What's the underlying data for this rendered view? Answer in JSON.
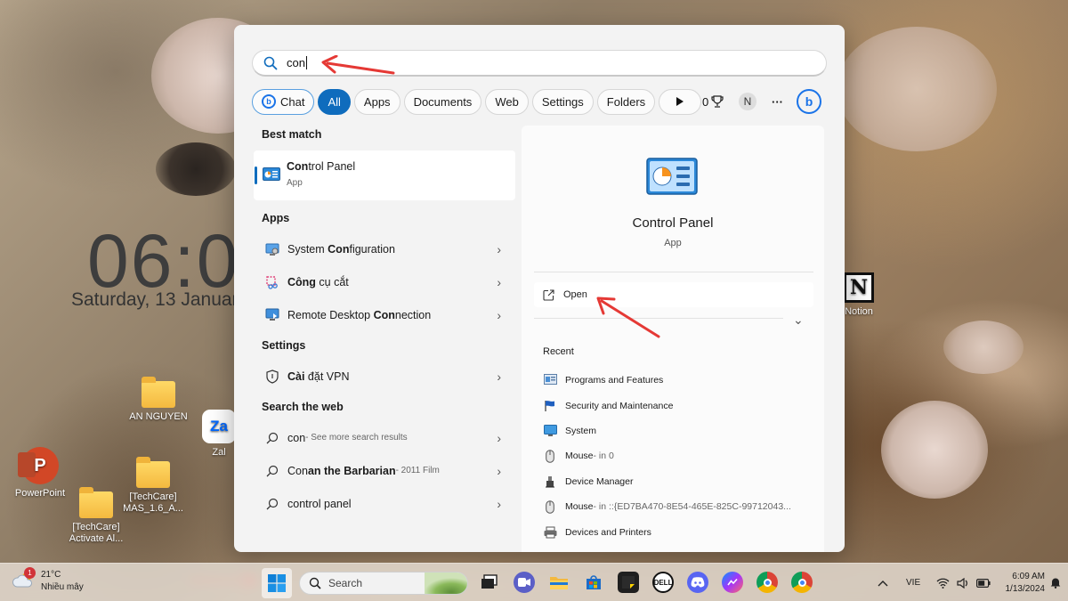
{
  "desktop": {
    "clock": "06:0",
    "date": "Saturday, 13 Januar",
    "icons": [
      {
        "label": "AN NGUYEN"
      },
      {
        "label": "Zal"
      },
      {
        "label": "PowerPoint"
      },
      {
        "label": "[TechCare]\nMAS_1.6_A..."
      },
      {
        "label": "[TechCare]\nActivate Al..."
      },
      {
        "label": "Notion"
      }
    ]
  },
  "search": {
    "query": "con",
    "filters": {
      "chat": "Chat",
      "all": "All",
      "apps": "Apps",
      "documents": "Documents",
      "web": "Web",
      "settings": "Settings",
      "folders": "Folders",
      "reward_points": "0",
      "account_initial": "N",
      "more": "···"
    },
    "best_match": {
      "title": "Best match",
      "name_bold": "Con",
      "name_rest": "trol Panel",
      "type": "App"
    },
    "apps_section": {
      "title": "Apps",
      "items": [
        {
          "pre": "System ",
          "bold": "Con",
          "post": "figuration"
        },
        {
          "pre": "",
          "bold": "Công",
          "post": " cụ cắt"
        },
        {
          "pre": "Remote Desktop ",
          "bold": "Con",
          "post": "nection"
        }
      ]
    },
    "settings_section": {
      "title": "Settings",
      "items": [
        {
          "pre": "",
          "bold": "Cài",
          "post": " đặt VPN"
        }
      ]
    },
    "web_section": {
      "title": "Search the web",
      "items": [
        {
          "main": "con",
          "bold": "",
          "sub": " - See more search results"
        },
        {
          "main": "Con",
          "bold": "an the Barbarian",
          "sub": " - 2011 Film"
        },
        {
          "main": "con",
          "bold": "trol panel",
          "sub": ""
        }
      ]
    },
    "detail": {
      "name": "Control Panel",
      "type": "App",
      "open_label": "Open",
      "recent_title": "Recent",
      "recent": [
        {
          "name": "Programs and Features",
          "detail": ""
        },
        {
          "name": "Security and Maintenance",
          "detail": ""
        },
        {
          "name": "System",
          "detail": ""
        },
        {
          "name": "Mouse",
          "detail": " - in 0"
        },
        {
          "name": "Device Manager",
          "detail": ""
        },
        {
          "name": "Mouse",
          "detail": " - in ::{ED7BA470-8E54-465E-825C-99712043..."
        },
        {
          "name": "Devices and Printers",
          "detail": ""
        }
      ]
    }
  },
  "taskbar": {
    "weather_temp": "21°C",
    "weather_desc": "Nhiều mây",
    "weather_badge": "1",
    "search_placeholder": "Search",
    "language": "VIE",
    "time": "6:09 AM",
    "date": "1/13/2024"
  },
  "colors": {
    "accent": "#0f6cbd",
    "annotation_arrow": "#e53935"
  }
}
